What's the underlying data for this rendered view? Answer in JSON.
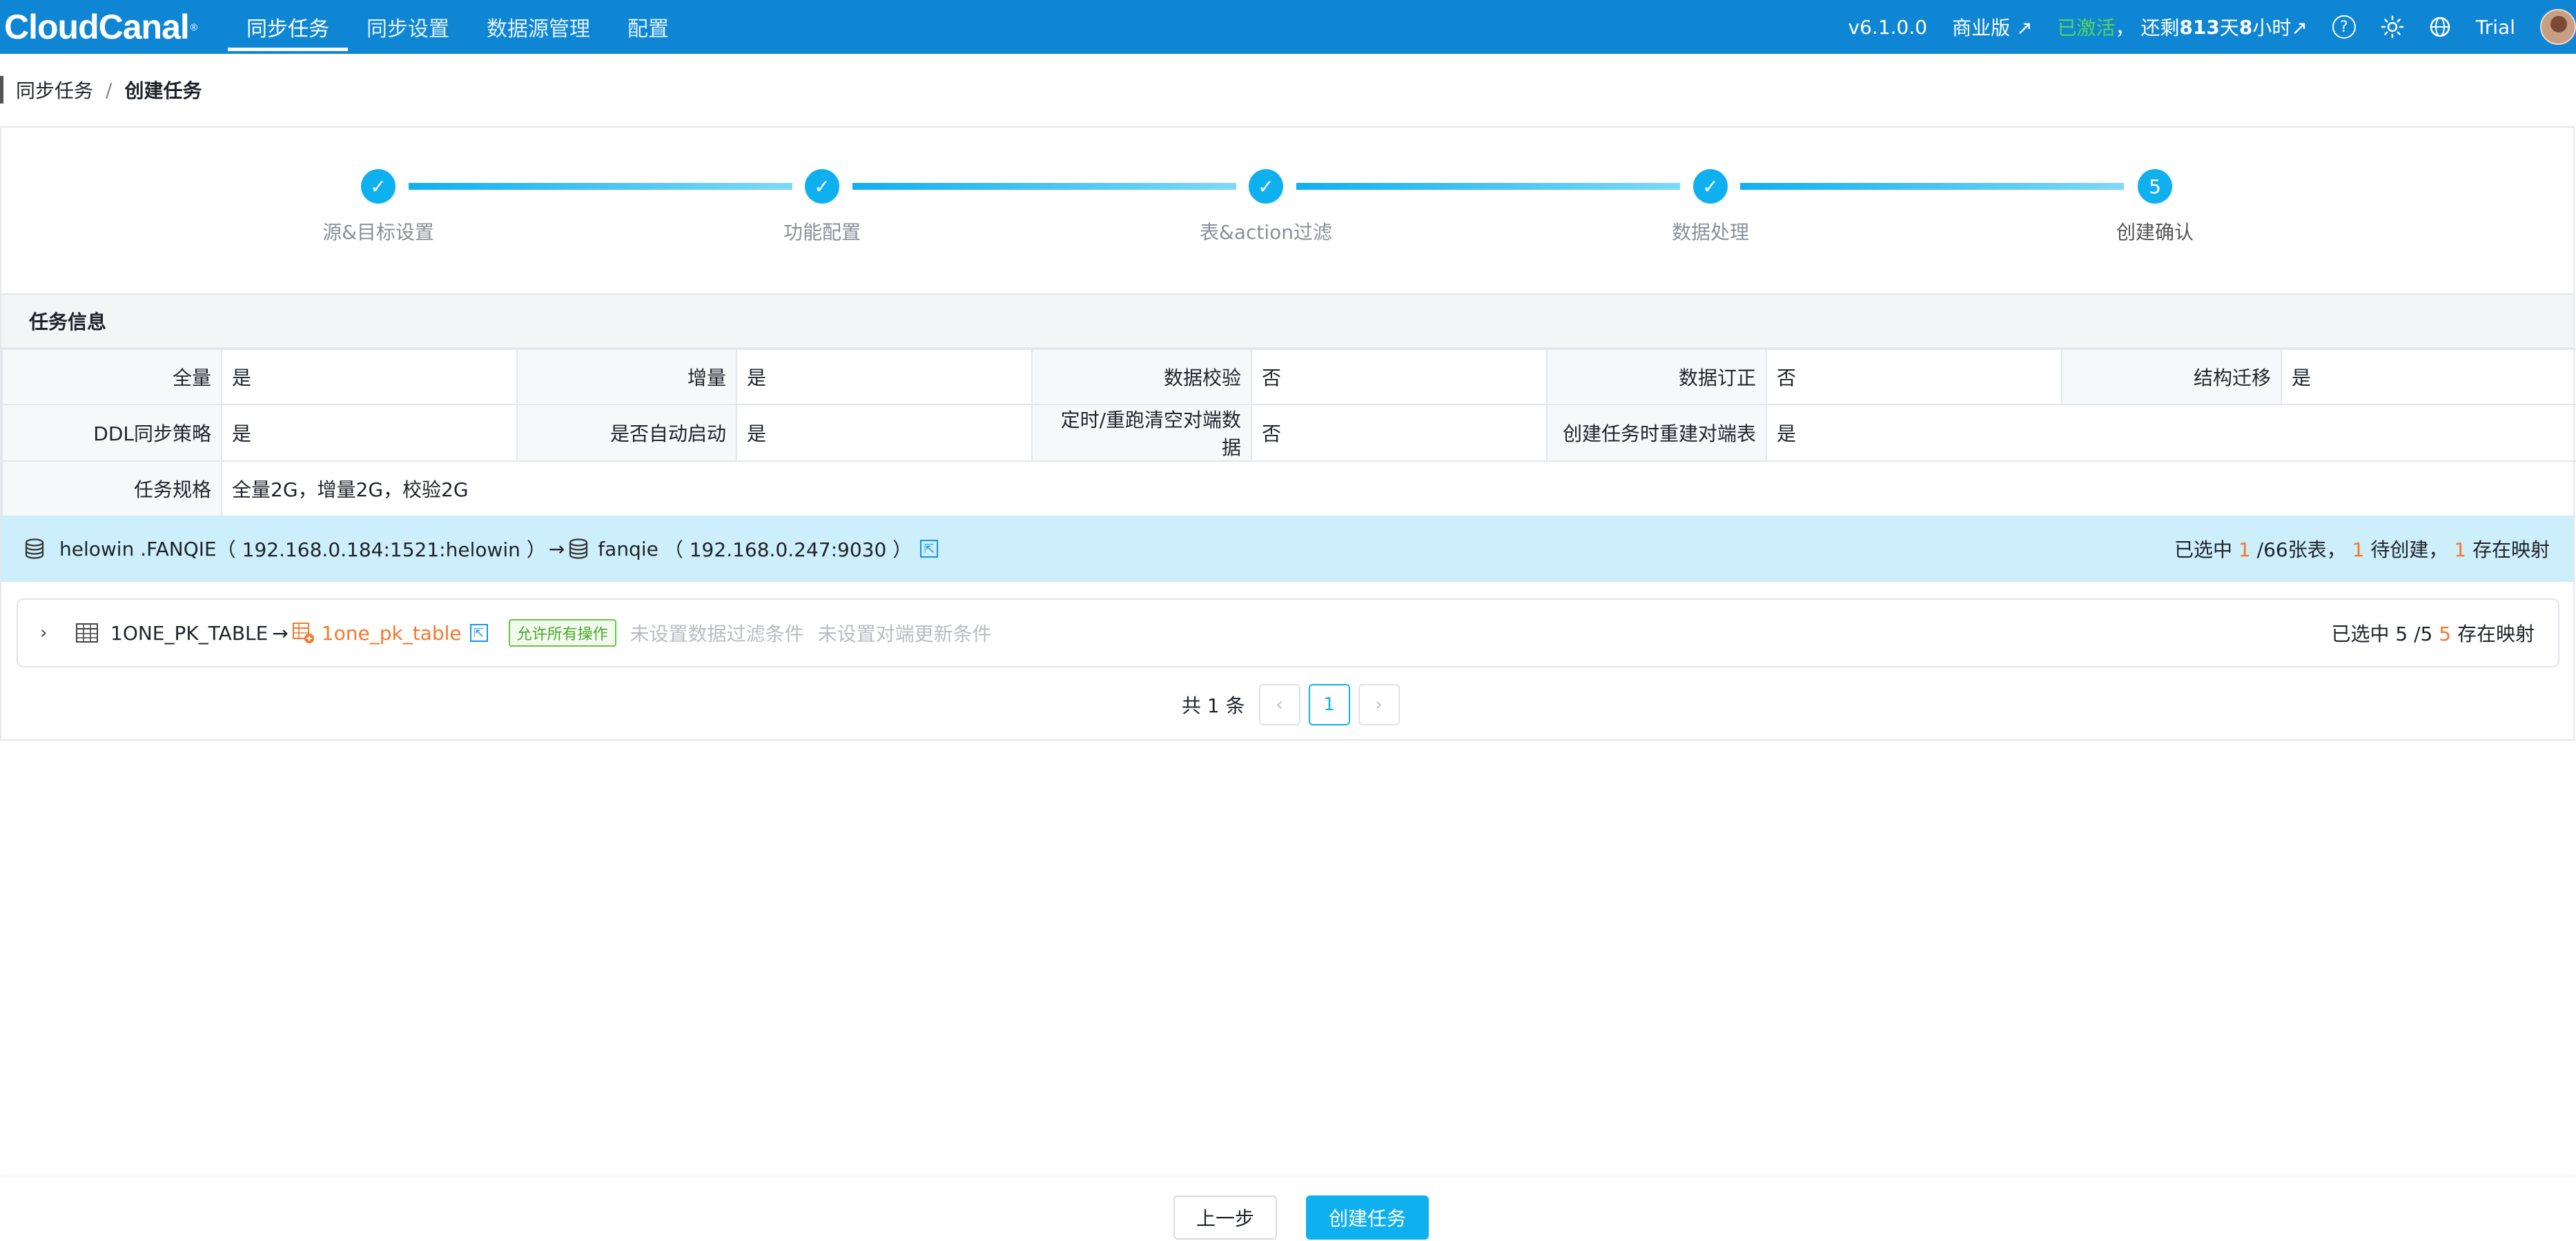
{
  "app": {
    "logo": "CloudCanal",
    "logo_mark": "®"
  },
  "nav": {
    "items": [
      "同步任务",
      "同步设置",
      "数据源管理",
      "配置"
    ],
    "active": "同步任务"
  },
  "topbar": {
    "version": "v6.1.0.0",
    "edition": "商业版 ↗",
    "activated": "已激活",
    "remain_prefix": "，  还剩 ",
    "remain_days": "813",
    "remain_days_unit": " 天 ",
    "remain_hours": "8",
    "remain_hours_unit": " 小时↗",
    "help_icon": "?",
    "user": "Trial",
    "icons": [
      "help-icon",
      "sun-icon",
      "globe-icon",
      "avatar"
    ]
  },
  "breadcrumb": {
    "parent": "同步任务",
    "separator": "/",
    "current": "创建任务"
  },
  "steps": [
    {
      "label": "源&目标设置",
      "state": "done",
      "symbol": "✓"
    },
    {
      "label": "功能配置",
      "state": "done",
      "symbol": "✓"
    },
    {
      "label": "表&action过滤",
      "state": "done",
      "symbol": "✓"
    },
    {
      "label": "数据处理",
      "state": "done",
      "symbol": "✓"
    },
    {
      "label": "创建确认",
      "state": "current",
      "symbol": "5"
    }
  ],
  "task_info": {
    "title": "任务信息",
    "row1": [
      {
        "k": "全量",
        "v": "是"
      },
      {
        "k": "增量",
        "v": "是"
      },
      {
        "k": "数据校验",
        "v": "否"
      },
      {
        "k": "数据订正",
        "v": "否"
      },
      {
        "k": "结构迁移",
        "v": "是"
      }
    ],
    "row2": [
      {
        "k": "DDL同步策略",
        "v": "是"
      },
      {
        "k": "是否自动启动",
        "v": "是"
      },
      {
        "k": "定时/重跑清空对端数据",
        "v": "否"
      },
      {
        "k": "创建任务时重建对端表",
        "v": "是"
      }
    ],
    "row3": {
      "k": "任务规格",
      "v": "全量2G，增量2G，校验2G"
    }
  },
  "mapping": {
    "source_name": "helowin .FANQIE",
    "source_addr": "（ 192.168.0.184:1521:helowin ）",
    "arrow": "→",
    "target_name": "fanqie",
    "target_addr": "（ 192.168.0.247:9030 ）",
    "link_symbol": "⇱",
    "selected_prefix": "已选中 ",
    "selected_count": "1",
    "selected_total": " /66张表，  ",
    "pending_count": "1",
    "pending_label": " 待创建，  ",
    "exist_count": "1",
    "exist_label": " 存在映射"
  },
  "table_row": {
    "chevron": "›",
    "source_table": "1ONE_PK_TABLE",
    "arrow": "→",
    "target_table": "1one_pk_table",
    "link_symbol": "⇱",
    "tag": "允许所有操作",
    "filter_hint": "未设置数据过滤条件",
    "update_hint": "未设置对端更新条件",
    "selected_prefix": "已选中 5 /5 ",
    "exist_count": "5",
    "exist_label": " 存在映射"
  },
  "pagination": {
    "total_label": "共 1 条",
    "prev": "‹",
    "current": "1",
    "next": "›"
  },
  "footer": {
    "prev_label": "上一步",
    "create_label": "创建任务"
  },
  "colors": {
    "topbar": "#0f86d4",
    "accent": "#0fb0f0",
    "activated": "#52d65a",
    "orange": "#f5782a",
    "banner": "#cdeefb"
  }
}
